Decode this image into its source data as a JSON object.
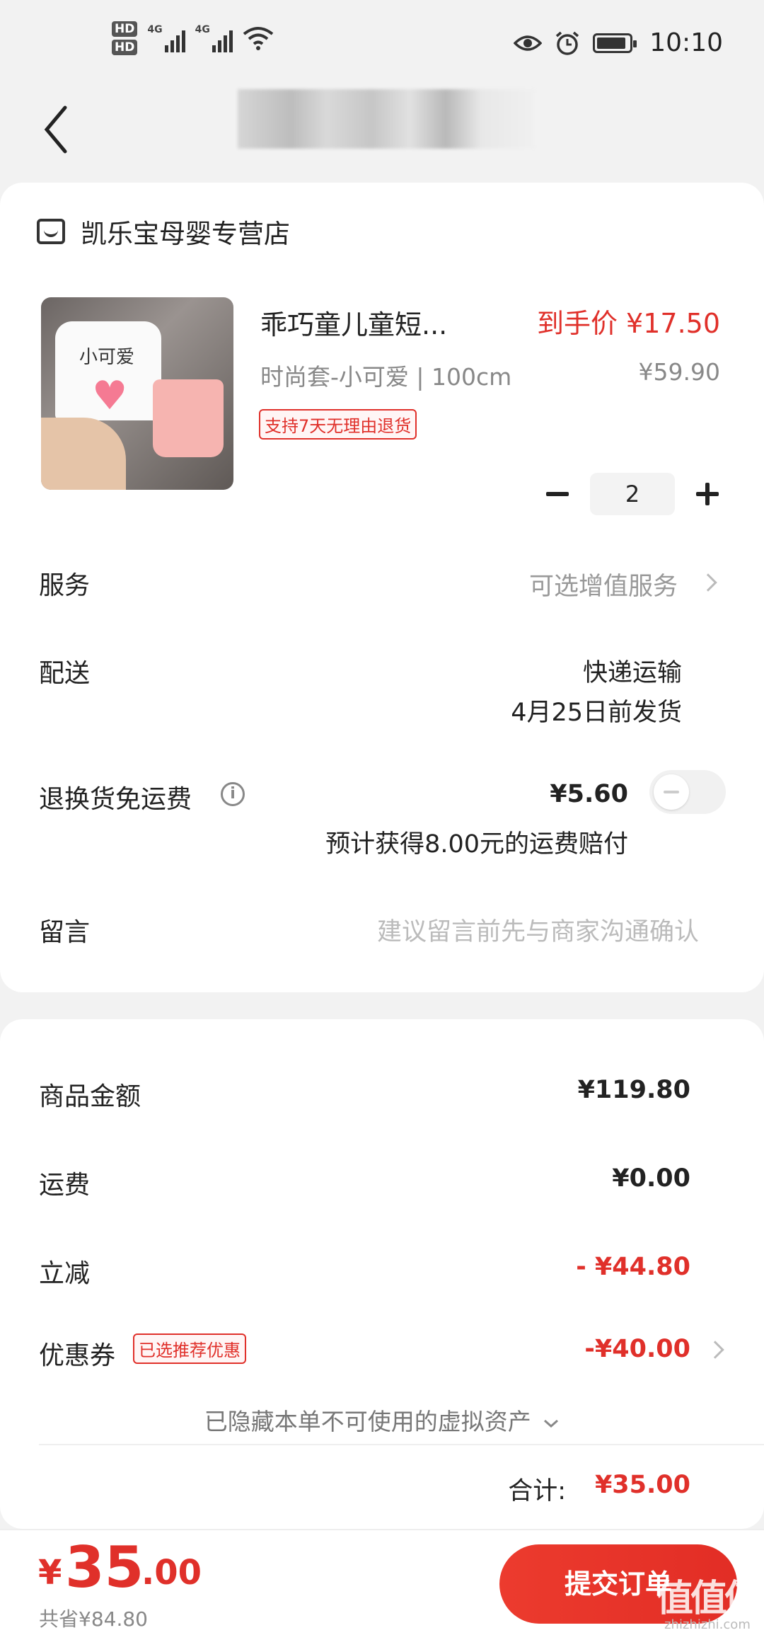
{
  "status_bar": {
    "hd1": "HD",
    "hd2": "HD",
    "net1": "4G",
    "net2": "4G",
    "time": "10:10",
    "icons": [
      "eye-icon",
      "alarm-icon",
      "battery-icon",
      "wifi-icon",
      "signal-icon"
    ]
  },
  "store": {
    "name": "凯乐宝母婴专营店"
  },
  "product": {
    "thumb_text": "小可爱",
    "name": "乖巧童儿童短...",
    "price": "到手价 ¥17.50",
    "spec": "时尚套-小可爱 | 100cm",
    "original_price": "¥59.90",
    "tag": "支持7天无理由退货",
    "quantity": "2"
  },
  "rows": {
    "service_label": "服务",
    "service_value": "可选增值服务",
    "delivery_label": "配送",
    "delivery_method": "快递运输",
    "delivery_date": "4月25日前发货",
    "return_label": "退换货免运费",
    "return_info_icon": "i",
    "return_price": "¥5.60",
    "return_note": "预计获得8.00元的运费赔付",
    "message_label": "留言",
    "message_placeholder": "建议留言前先与商家沟通确认"
  },
  "summary": {
    "goods_label": "商品金额",
    "goods_value": "¥119.80",
    "shipping_label": "运费",
    "shipping_value": "¥0.00",
    "discount_label": "立减",
    "discount_value": "- ¥44.80",
    "coupon_label": "优惠券",
    "coupon_tag": "已选推荐优惠",
    "coupon_value": "-¥40.00",
    "hidden_note": "已隐藏本单不可使用的虚拟资产",
    "total_label": "合计:",
    "total_value": "¥35.00"
  },
  "bottom": {
    "yen": "¥",
    "amount_int": "35",
    "amount_dec": ".00",
    "saved": "共省¥84.80",
    "submit": "提交订单"
  },
  "watermark": {
    "mark": "值值值",
    "url": "zhizhizhi.com"
  },
  "colors": {
    "accent": "#e0302a",
    "background": "#f2f2f2"
  }
}
